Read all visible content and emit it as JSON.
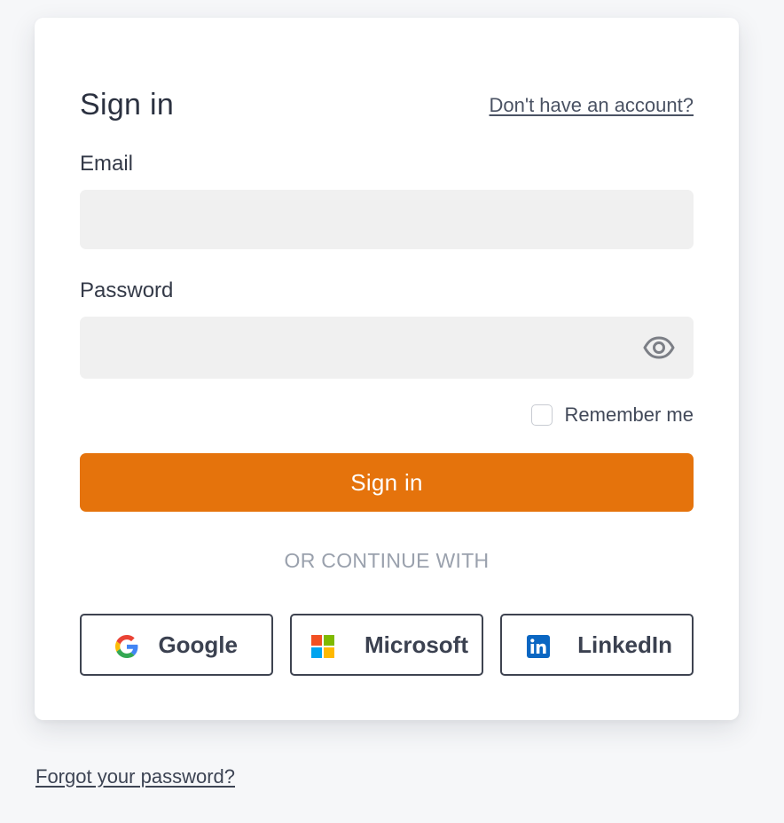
{
  "signin": {
    "title": "Sign in",
    "signup_link": "Don't have an account?",
    "email_label": "Email",
    "email_value": "",
    "password_label": "Password",
    "password_value": "",
    "remember_label": "Remember me",
    "remember_checked": false,
    "submit_label": "Sign in",
    "divider_text": "OR CONTINUE WITH",
    "social": [
      {
        "label": "Google",
        "icon": "google-icon"
      },
      {
        "label": "Microsoft",
        "icon": "microsoft-icon"
      },
      {
        "label": "LinkedIn",
        "icon": "linkedin-icon"
      }
    ]
  },
  "footer": {
    "forgot_link": "Forgot your password?"
  },
  "colors": {
    "accent": "#e5730c",
    "background": "#f6f7f9",
    "card": "#ffffff",
    "input_bg": "#f0f0f0",
    "divider_text": "#9aa1ad",
    "linkedin_blue": "#0a66c2"
  }
}
